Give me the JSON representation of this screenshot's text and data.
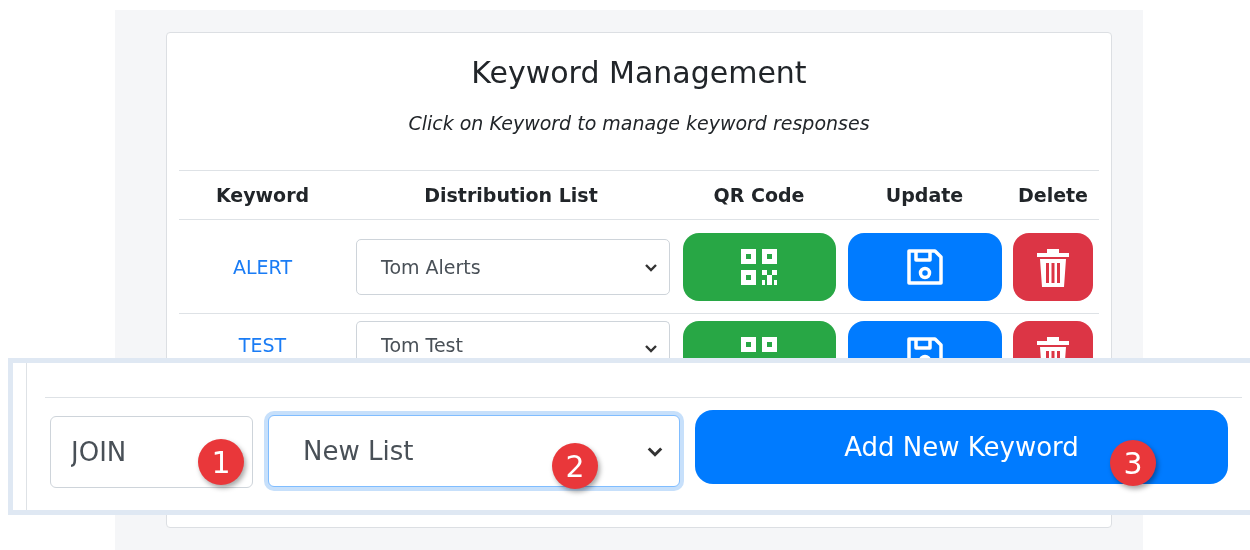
{
  "title": "Keyword Management",
  "subtitle": "Click on Keyword to manage keyword responses",
  "columns": [
    "Keyword",
    "Distribution List",
    "QR Code",
    "Update",
    "Delete"
  ],
  "rows": [
    {
      "keyword": "ALERT",
      "list": "Tom Alerts"
    },
    {
      "keyword": "TEST",
      "list": "Tom Test"
    }
  ],
  "new_keyword": {
    "value": "JOIN",
    "list": "New List",
    "list_focused": true,
    "button": "Add New Keyword"
  },
  "callouts": [
    "1",
    "2",
    "3"
  ]
}
